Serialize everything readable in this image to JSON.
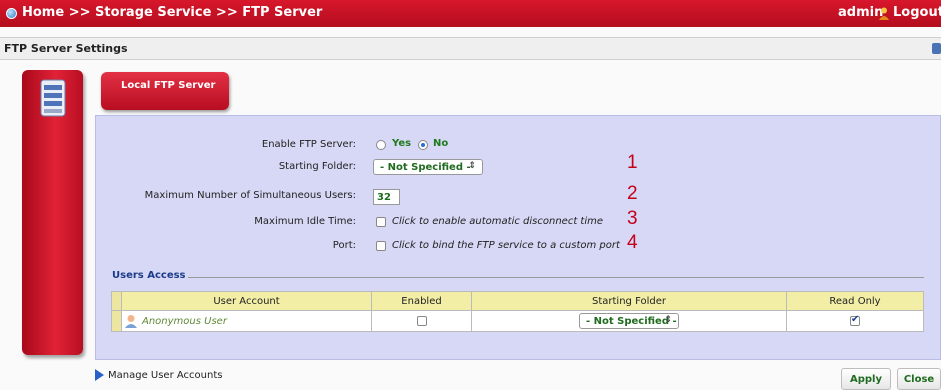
{
  "header": {
    "breadcrumb": "Home >> Storage Service >> FTP Server",
    "user": "admin",
    "logout_label": "Logout"
  },
  "section": {
    "title": "FTP Server Settings"
  },
  "tab": {
    "label": "Local FTP Server"
  },
  "form": {
    "enable_label": "Enable FTP Server:",
    "yes_label": "Yes",
    "no_label": "No",
    "enable_value": "No",
    "starting_folder_label": "Starting Folder:",
    "starting_folder_value": "- Not Specified -",
    "max_users_label": "Maximum Number of Simultaneous Users:",
    "max_users_value": "32",
    "idle_label": "Maximum Idle Time:",
    "idle_hint": "Click to enable automatic disconnect time",
    "port_label": "Port:",
    "port_hint": "Click to bind the FTP service to a custom port"
  },
  "callouts": [
    "1",
    "2",
    "3",
    "4"
  ],
  "users_access": {
    "legend": "Users Access",
    "columns": [
      "User Account",
      "Enabled",
      "Starting Folder",
      "Read Only"
    ],
    "rows": [
      {
        "account": "Anonymous User",
        "enabled": false,
        "starting_folder": "- Not Specified -",
        "read_only": true
      }
    ]
  },
  "footer": {
    "manage_label": "Manage User Accounts",
    "apply_label": "Apply",
    "close_label": "Close"
  },
  "colors": {
    "header_red": "#c8102e",
    "panel_bg": "#d7d8f5",
    "callout_red": "#c4001a",
    "value_green": "#1f6b1f"
  }
}
